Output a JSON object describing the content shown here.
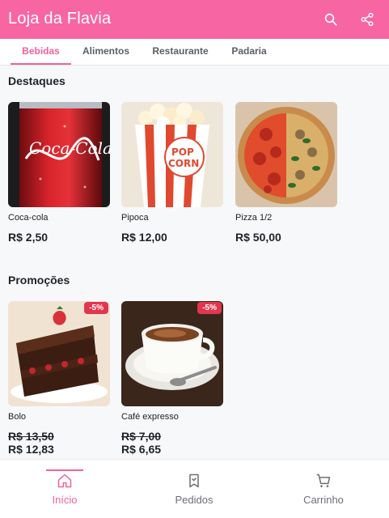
{
  "header": {
    "title": "Loja da Flavia",
    "search_icon": "search-icon",
    "share_icon": "share-icon",
    "bg": "#f766a3"
  },
  "tabs": [
    {
      "label": "Bebidas",
      "active": true
    },
    {
      "label": "Alimentos",
      "active": false
    },
    {
      "label": "Restaurante",
      "active": false
    },
    {
      "label": "Padaria",
      "active": false
    }
  ],
  "highlights": {
    "title": "Destaques",
    "items": [
      {
        "name": "Coca-cola",
        "price": "R$ 2,50",
        "image": "coca-cola-can"
      },
      {
        "name": "Pipoca",
        "price": "R$ 12,00",
        "image": "popcorn-box"
      },
      {
        "name": "Pizza 1/2",
        "price": "R$ 50,00",
        "image": "pizza"
      }
    ]
  },
  "promotions": {
    "title": "Promoções",
    "items": [
      {
        "name": "Bolo",
        "old_price": "R$ 13,50",
        "new_price": "R$ 12,83",
        "discount": "-5%",
        "image": "chocolate-cake"
      },
      {
        "name": "Café expresso",
        "old_price": "R$ 7,00",
        "new_price": "R$ 6,65",
        "discount": "-5%",
        "image": "espresso-cup"
      }
    ]
  },
  "bottom_nav": [
    {
      "label": "Início",
      "icon": "home-icon",
      "active": true
    },
    {
      "label": "Pedidos",
      "icon": "orders-icon",
      "active": false
    },
    {
      "label": "Carrinho",
      "icon": "cart-icon",
      "active": false
    }
  ],
  "colors": {
    "accent": "#f0629c",
    "badge": "#e1374e"
  }
}
